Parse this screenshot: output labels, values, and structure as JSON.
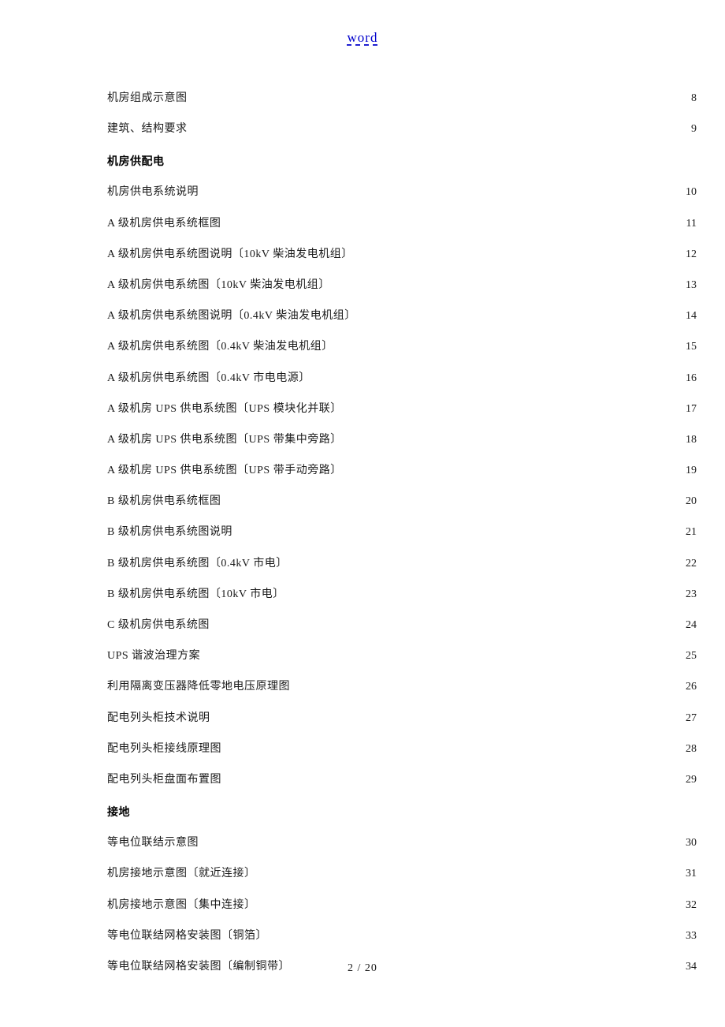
{
  "header": {
    "title": "word"
  },
  "toc": {
    "preSection": [
      {
        "label": "机房组成示意图",
        "page": "8"
      },
      {
        "label": "建筑、结构要求",
        "page": "9"
      }
    ],
    "section1": {
      "heading": "机房供配电",
      "items": [
        {
          "label": "机房供电系统说明",
          "page": "10"
        },
        {
          "label": "A 级机房供电系统框图",
          "page": "11"
        },
        {
          "label": "A 级机房供电系统图说明〔10kV 柴油发电机组〕",
          "page": "12"
        },
        {
          "label": "A 级机房供电系统图〔10kV 柴油发电机组〕",
          "page": "13"
        },
        {
          "label": "A 级机房供电系统图说明〔0.4kV 柴油发电机组〕",
          "page": "14"
        },
        {
          "label": "A 级机房供电系统图〔0.4kV 柴油发电机组〕",
          "page": "15"
        },
        {
          "label": "A 级机房供电系统图〔0.4kV 市电电源〕",
          "page": "16"
        },
        {
          "label": "A 级机房 UPS 供电系统图〔UPS 模块化并联〕",
          "page": "17"
        },
        {
          "label": "A 级机房 UPS 供电系统图〔UPS 带集中旁路〕",
          "page": "18"
        },
        {
          "label": "A 级机房 UPS 供电系统图〔UPS 带手动旁路〕",
          "page": "19"
        },
        {
          "label": "B 级机房供电系统框图",
          "page": "20"
        },
        {
          "label": "B 级机房供电系统图说明",
          "page": "21"
        },
        {
          "label": "B 级机房供电系统图〔0.4kV 市电〕",
          "page": "22"
        },
        {
          "label": "B 级机房供电系统图〔10kV 市电〕",
          "page": "23"
        },
        {
          "label": "C 级机房供电系统图",
          "page": "24"
        },
        {
          "label": "UPS 谐波治理方案",
          "page": "25"
        },
        {
          "label": "利用隔离变压器降低零地电压原理图",
          "page": "26"
        },
        {
          "label": "配电列头柜技术说明",
          "page": "27"
        },
        {
          "label": "配电列头柜接线原理图",
          "page": "28"
        },
        {
          "label": "配电列头柜盘面布置图",
          "page": "29"
        }
      ]
    },
    "section2": {
      "heading": "接地",
      "items": [
        {
          "label": "等电位联结示意图",
          "page": "30"
        },
        {
          "label": "机房接地示意图〔就近连接〕",
          "page": "31"
        },
        {
          "label": "机房接地示意图〔集中连接〕",
          "page": "32"
        },
        {
          "label": "等电位联结网格安装图〔铜箔〕",
          "page": "33"
        },
        {
          "label": "等电位联结网格安装图〔编制铜带〕",
          "page": "34"
        }
      ]
    }
  },
  "footer": {
    "pageIndicator": "2 / 20"
  }
}
